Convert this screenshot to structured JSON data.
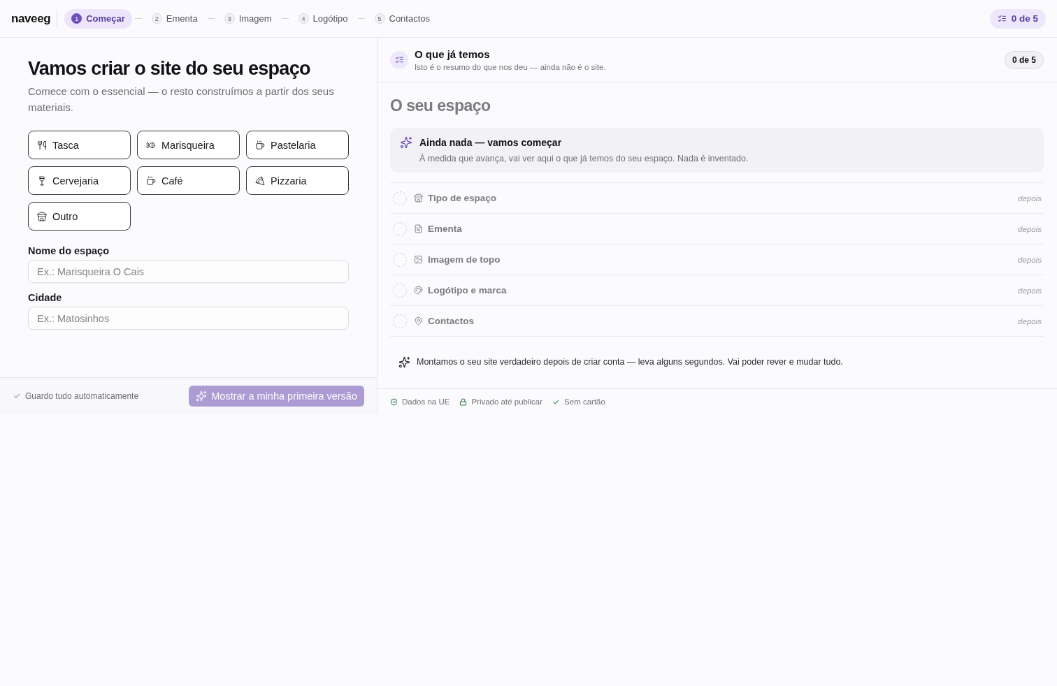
{
  "topbar": {
    "logo": "naveeg",
    "steps": [
      {
        "number": "1",
        "label": "Começar",
        "selected": true
      },
      {
        "number": "2",
        "label": "Ementa",
        "selected": false
      },
      {
        "number": "3",
        "label": "Imagem",
        "selected": false
      },
      {
        "number": "4",
        "label": "Logótipo",
        "selected": false
      },
      {
        "number": "5",
        "label": "Contactos",
        "selected": false
      }
    ],
    "progress": "0 de 5"
  },
  "form": {
    "title": "Vamos criar o site do seu espaço",
    "subtitle": "Comece com o essencial — o resto construímos a partir dos seus materiais.",
    "types": [
      {
        "label": "Tasca",
        "selected": false
      },
      {
        "label": "Marisqueira",
        "selected": false
      },
      {
        "label": "Pastelaria",
        "selected": false
      },
      {
        "label": "Cervejaria",
        "selected": false
      },
      {
        "label": "Café",
        "selected": false
      },
      {
        "label": "Pizzaria",
        "selected": false
      },
      {
        "label": "Outro",
        "selected": false
      }
    ],
    "fields": [
      {
        "label": "Nome do espaço",
        "placeholder": "Ex.: Marisqueira O Cais"
      },
      {
        "label": "Cidade",
        "placeholder": "Ex.: Matosinhos"
      }
    ],
    "autosave": "Guardo tudo automaticamente",
    "submit": {
      "label": "Mostrar a minha primeira versão",
      "disabled": true
    }
  },
  "summary": {
    "title": "O que já temos",
    "subtitle": "Isto é o resumo do que nos deu — ainda não é o site.",
    "count": "0 de 5",
    "heading": "O seu espaço",
    "empty": {
      "title": "Ainda nada — vamos começar",
      "text": "À medida que avança, vai ver aqui o que já temos do seu espaço. Nada é inventado."
    },
    "items": [
      {
        "label": "Tipo de espaço",
        "status": "depois",
        "done": false
      },
      {
        "label": "Ementa",
        "status": "depois",
        "done": false
      },
      {
        "label": "Imagem de topo",
        "status": "depois",
        "done": false
      },
      {
        "label": "Logótipo e marca",
        "status": "depois",
        "done": false
      },
      {
        "label": "Contactos",
        "status": "depois",
        "done": false
      }
    ],
    "note": "Montamos o seu site verdadeiro depois de criar conta — leva alguns segundos. Vai poder rever e mudar tudo.",
    "badges": [
      "Dados na UE",
      "Privado até publicar",
      "Sem cartão"
    ]
  }
}
